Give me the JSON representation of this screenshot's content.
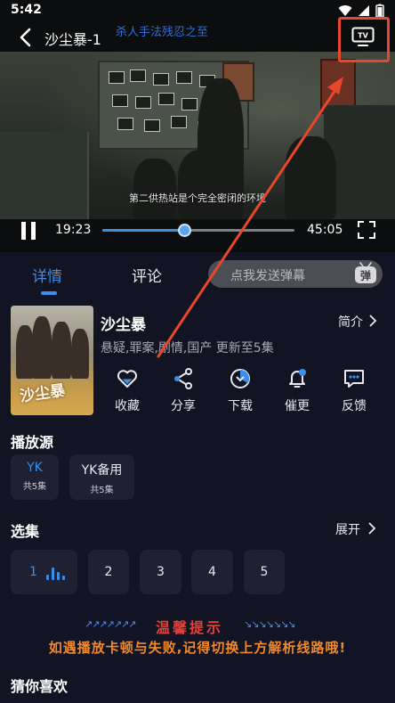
{
  "status_bar": {
    "time": "5:42"
  },
  "top_bar": {
    "title": "沙尘暴-1",
    "marquee": "杀人手法残忍之至"
  },
  "video": {
    "subtitle": "第二供热站是个完全密闭的环境"
  },
  "controls": {
    "current_time": "19:23",
    "total_time": "45:05",
    "progress": 0.43
  },
  "tabs": [
    {
      "label": "详情",
      "active": true
    },
    {
      "label": "评论",
      "active": false
    }
  ],
  "danmaku": {
    "placeholder": "点我发送弹幕",
    "icon_char": "弹"
  },
  "show": {
    "title": "沙尘暴",
    "intro_label": "简介",
    "genre": "悬疑,罪案,剧情,国产 更新至5集",
    "poster_text": "沙尘暴"
  },
  "actions": [
    {
      "label": "收藏",
      "icon": "heart-icon"
    },
    {
      "label": "分享",
      "icon": "share-icon"
    },
    {
      "label": "下载",
      "icon": "download-icon"
    },
    {
      "label": "催更",
      "icon": "bell-icon"
    },
    {
      "label": "反馈",
      "icon": "feedback-icon"
    }
  ],
  "sources": {
    "heading": "播放源",
    "items": [
      {
        "name": "YK",
        "count": "共5集",
        "active": true
      },
      {
        "name": "YK备用",
        "count": "共5集",
        "active": false
      }
    ]
  },
  "episodes": {
    "heading": "选集",
    "expand_label": "展开",
    "items": [
      "1",
      "2",
      "3",
      "4",
      "5"
    ],
    "active_index": 0
  },
  "notice": {
    "title": "温馨提示",
    "arrows_left": "↗↗↗↗↗↗↗",
    "arrows_right": "↘↘↘↘↘↘↘",
    "body": "如遇播放卡顿与失败,记得切换上方解析线路哦!"
  },
  "guess": {
    "heading": "猜你喜欢"
  },
  "colors": {
    "accent": "#3b8fe8",
    "background": "#131423",
    "card": "#1f2133",
    "highlight_box": "#e8472c",
    "notice_title": "#e0413a",
    "notice_body": "#ee8a2e"
  }
}
